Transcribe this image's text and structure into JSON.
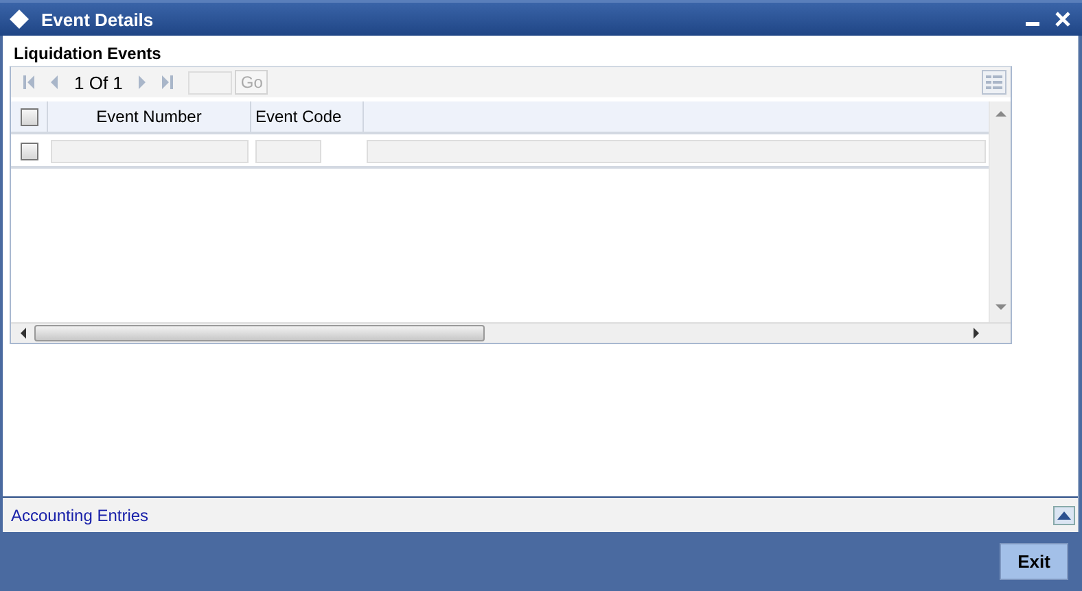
{
  "window": {
    "title": "Event Details"
  },
  "section": {
    "title": "Liquidation Events"
  },
  "pager": {
    "position": "1 Of 1",
    "go_label": "Go"
  },
  "table": {
    "select_all": {
      "checked": false
    },
    "columns": [
      "Event Number",
      "Event Code"
    ],
    "rows": [
      {
        "checked": false
      }
    ]
  },
  "footer": {
    "link": "Accounting Entries"
  },
  "buttons": [
    "Exit"
  ]
}
